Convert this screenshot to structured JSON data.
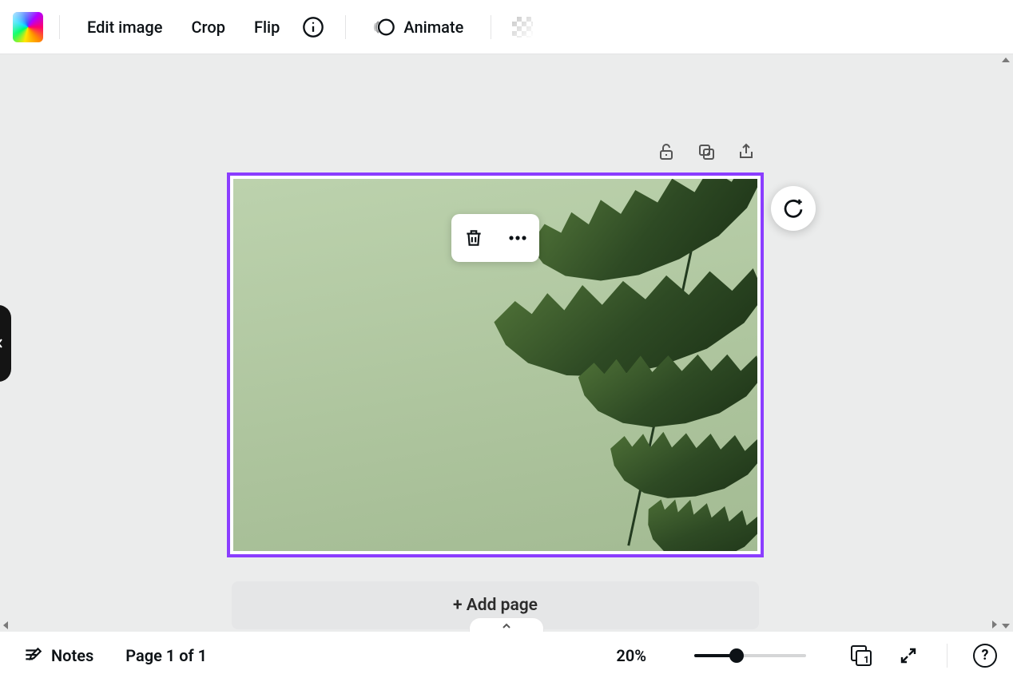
{
  "toolbar": {
    "edit_image": "Edit image",
    "crop": "Crop",
    "flip": "Flip",
    "animate": "Animate"
  },
  "context_menu": {
    "delete_icon": "trash",
    "more_icon": "dots"
  },
  "add_page_label": "+ Add page",
  "footer": {
    "notes_label": "Notes",
    "page_label": "Page 1 of 1",
    "zoom_label": "20%",
    "grid_badge": "1",
    "help_label": "?"
  }
}
